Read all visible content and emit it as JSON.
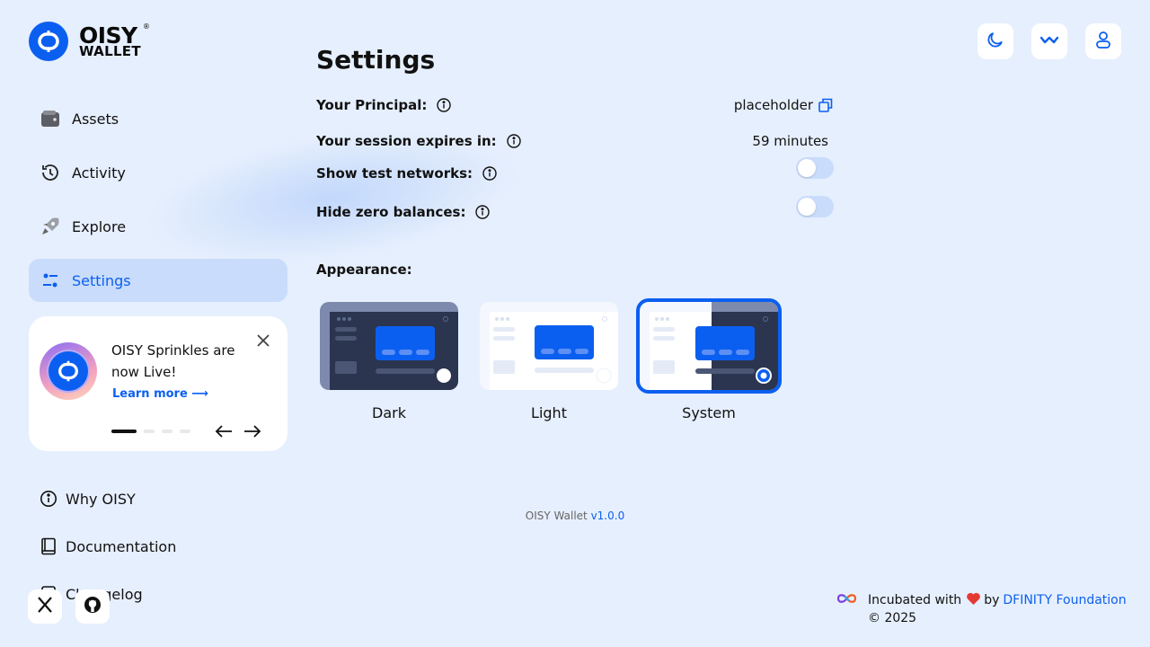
{
  "logo": {
    "line1": "OISY",
    "line2": "WALLET",
    "reg": "®"
  },
  "sidebar": {
    "items": [
      {
        "label": "Assets"
      },
      {
        "label": "Activity"
      },
      {
        "label": "Explore"
      },
      {
        "label": "Settings"
      }
    ],
    "active": "Settings"
  },
  "promo": {
    "title": "OISY Sprinkles are now Live!",
    "link": "Learn more ⟶",
    "total_slides": 4,
    "current_slide": 1
  },
  "bottom_links": [
    {
      "label": "Why OISY"
    },
    {
      "label": "Documentation"
    },
    {
      "label": "Changelog"
    }
  ],
  "page": {
    "title": "Settings",
    "principal_label": "Your Principal:",
    "principal_value": "placeholder",
    "session_label": "Your session expires in:",
    "session_value": "59 minutes",
    "test_networks_label": "Show test networks:",
    "test_networks_on": false,
    "zero_balances_label": "Hide zero balances:",
    "zero_balances_on": false,
    "appearance_label": "Appearance:",
    "themes": [
      {
        "label": "Dark"
      },
      {
        "label": "Light"
      },
      {
        "label": "System"
      }
    ],
    "selected_theme": "System"
  },
  "version": {
    "prefix": "OISY Wallet",
    "number": "v1.0.0"
  },
  "footer": {
    "incubated": "Incubated with",
    "by": "by",
    "org": "DFINITY Foundation",
    "copyright": "© 2025"
  },
  "colors": {
    "accent": "#0b5ff0",
    "background": "#e6effd",
    "active_nav": "#c9dcfb"
  }
}
